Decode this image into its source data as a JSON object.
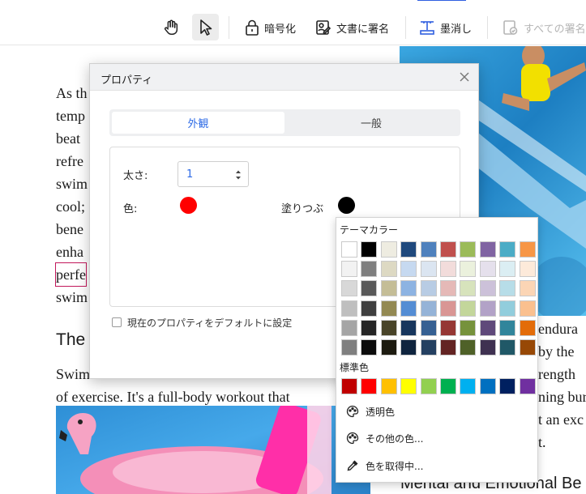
{
  "toolbar": {
    "items": [
      {
        "name": "hand",
        "label": ""
      },
      {
        "name": "select",
        "label": ""
      },
      {
        "name": "encrypt",
        "label": "暗号化"
      },
      {
        "name": "sign",
        "label": "文書に署名"
      },
      {
        "name": "redact",
        "label": "墨消し"
      },
      {
        "name": "sign-all",
        "label": "すべての署名"
      }
    ]
  },
  "document": {
    "lines": [
      "As th",
      "temp",
      "beat",
      "refre",
      "swim",
      "cool;",
      "bene",
      "enha",
      "perfe",
      "swim"
    ],
    "heading": "The",
    "para2": [
      "Swim",
      "of exercise. It's a full-body workout that"
    ],
    "right_lines": [
      "endura",
      "by the",
      "rength",
      "ning bur",
      "t an exc",
      "t."
    ],
    "right_heading": "Mental and Emotional Be"
  },
  "dialog": {
    "title": "プロパティ",
    "tabs": [
      {
        "label": "外観"
      },
      {
        "label": "一般"
      }
    ],
    "thickness_label": "太さ:",
    "thickness_value": "1",
    "color_label": "色:",
    "fill_label": "塗りつぶ",
    "color_value": "#ff0000",
    "fill_value": "#000000",
    "default_checkbox_label": "現在のプロパティをデフォルトに設定"
  },
  "picker": {
    "theme_title": "テーマカラー",
    "standard_title": "標準色",
    "theme_rows": [
      [
        "#ffffff",
        "#000000",
        "#eeece1",
        "#1f497d",
        "#4f81bd",
        "#c0504d",
        "#9bbb59",
        "#8064a2",
        "#4bacc6",
        "#f79646"
      ],
      [
        "#f2f2f2",
        "#7f7f7f",
        "#ddd9c3",
        "#c6d9f0",
        "#dbe5f1",
        "#f2dcdb",
        "#ebf1dd",
        "#e5e0ec",
        "#dbeef3",
        "#fdeada"
      ],
      [
        "#d8d8d8",
        "#595959",
        "#c4bd97",
        "#8db3e2",
        "#b8cce4",
        "#e5b9b7",
        "#d7e3bc",
        "#ccc1d9",
        "#b7dde8",
        "#fbd5b5"
      ],
      [
        "#bfbfbf",
        "#3f3f3f",
        "#938953",
        "#548dd4",
        "#95b3d7",
        "#d99694",
        "#c3d69b",
        "#b2a2c7",
        "#92cddc",
        "#fac08f"
      ],
      [
        "#a5a5a5",
        "#262626",
        "#494429",
        "#17365d",
        "#366092",
        "#953734",
        "#76923c",
        "#5f497a",
        "#31859b",
        "#e36c09"
      ],
      [
        "#7f7f7f",
        "#0c0c0c",
        "#1d1b10",
        "#0f243e",
        "#244061",
        "#632423",
        "#4f6128",
        "#3f3151",
        "#205867",
        "#974806"
      ]
    ],
    "standard_row": [
      "#c00000",
      "#ff0000",
      "#ffc000",
      "#ffff00",
      "#92d050",
      "#00b050",
      "#00b0f0",
      "#0070c0",
      "#002060",
      "#7030a0"
    ],
    "actions": [
      {
        "label": "透明色"
      },
      {
        "label": "その他の色..."
      },
      {
        "label": "色を取得中..."
      }
    ]
  }
}
